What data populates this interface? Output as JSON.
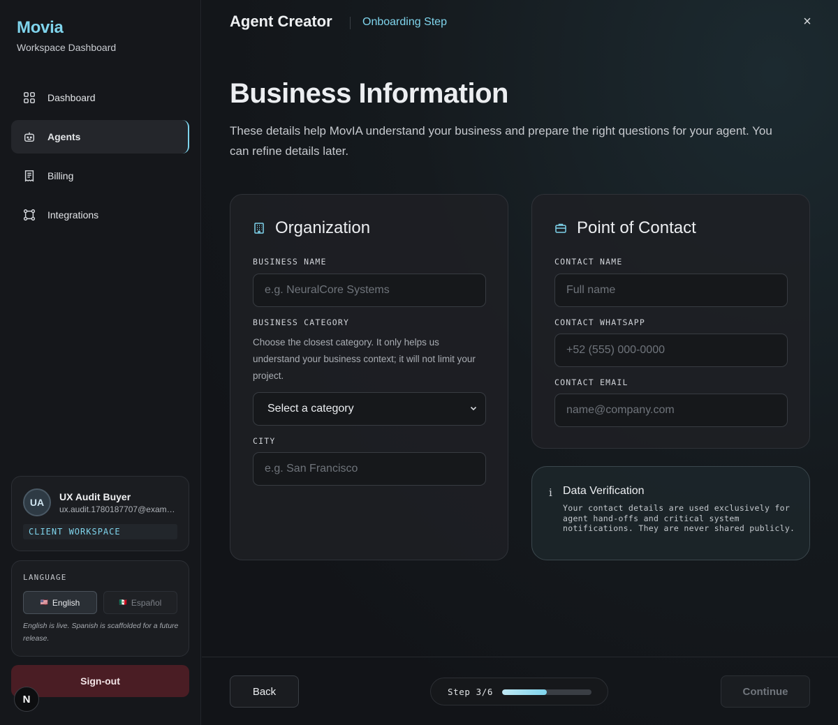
{
  "brand": {
    "name": "Movia",
    "subtitle": "Workspace Dashboard"
  },
  "sidebar": {
    "items": [
      {
        "label": "Dashboard",
        "icon": "grid-icon",
        "active": false
      },
      {
        "label": "Agents",
        "icon": "robot-icon",
        "active": true
      },
      {
        "label": "Billing",
        "icon": "receipt-icon",
        "active": false
      },
      {
        "label": "Integrations",
        "icon": "nodes-icon",
        "active": false
      }
    ]
  },
  "user": {
    "initials": "UA",
    "name": "UX Audit Buyer",
    "email": "ux.audit.1780187707@exampl...",
    "workspace_badge": "CLIENT WORKSPACE"
  },
  "language": {
    "title": "LANGUAGE",
    "options": [
      {
        "label": "English",
        "flag": "🇺🇸",
        "selected": true
      },
      {
        "label": "Español",
        "flag": "🇲🇽",
        "selected": false
      }
    ],
    "note": "English is live. Spanish is scaffolded for a future release."
  },
  "signout_label": "Sign-out",
  "n_badge": "N",
  "topbar": {
    "title": "Agent Creator",
    "step": "Onboarding Step",
    "close": "×"
  },
  "page": {
    "title": "Business Information",
    "description": "These details help MovIA understand your business and prepare the right questions for your agent. You can refine details later."
  },
  "organization": {
    "title": "Organization",
    "business_name_label": "BUSINESS NAME",
    "business_name_placeholder": "e.g. NeuralCore Systems",
    "category_label": "BUSINESS CATEGORY",
    "category_help": "Choose the closest category. It only helps us understand your business context; it will not limit your project.",
    "category_selected": "Select a category",
    "city_label": "CITY",
    "city_placeholder": "e.g. San Francisco"
  },
  "contact": {
    "title": "Point of Contact",
    "name_label": "CONTACT NAME",
    "name_placeholder": "Full name",
    "whatsapp_label": "CONTACT WHATSAPP",
    "whatsapp_placeholder": "+52 (555) 000-0000",
    "email_label": "CONTACT EMAIL",
    "email_placeholder": "name@company.com"
  },
  "verification": {
    "icon": "i",
    "title": "Data Verification",
    "text": "Your contact details are used exclusively for agent hand-offs and critical system notifications. They are never shared publicly."
  },
  "footer": {
    "back_label": "Back",
    "step_text": "Step 3/6",
    "progress_fraction": 0.5,
    "continue_label": "Continue"
  },
  "colors": {
    "accent": "#7fd4ec",
    "signout": "#4a1d24"
  }
}
